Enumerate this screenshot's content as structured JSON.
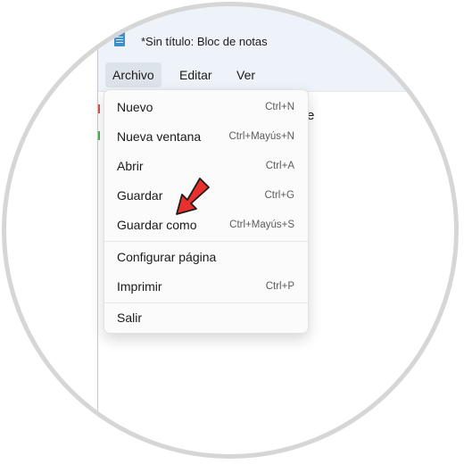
{
  "window": {
    "title": "*Sin título: Bloc de notas",
    "icon": "notepad-icon"
  },
  "menubar": {
    "items": [
      {
        "label": "Archivo",
        "active": true
      },
      {
        "label": "Editar"
      },
      {
        "label": "Ver"
      }
    ]
  },
  "dropdown": {
    "items": [
      {
        "label": "Nuevo",
        "shortcut": "Ctrl+N"
      },
      {
        "label": "Nueva ventana",
        "shortcut": "Ctrl+Mayús+N"
      },
      {
        "label": "Abrir",
        "shortcut": "Ctrl+A"
      },
      {
        "label": "Guardar",
        "shortcut": "Ctrl+G"
      },
      {
        "label": "Guardar como",
        "shortcut": "Ctrl+Mayús+S"
      },
      {
        "label": "Configurar página",
        "shortcut": ""
      },
      {
        "label": "Imprimir",
        "shortcut": "Ctrl+P"
      },
      {
        "label": "Salir",
        "shortcut": ""
      }
    ]
  },
  "editor": {
    "partial_text": "e"
  },
  "colors": {
    "titlebar_bg": "#eef3f9",
    "accent": "#3c8fc9",
    "arrow": "#e8312c"
  }
}
